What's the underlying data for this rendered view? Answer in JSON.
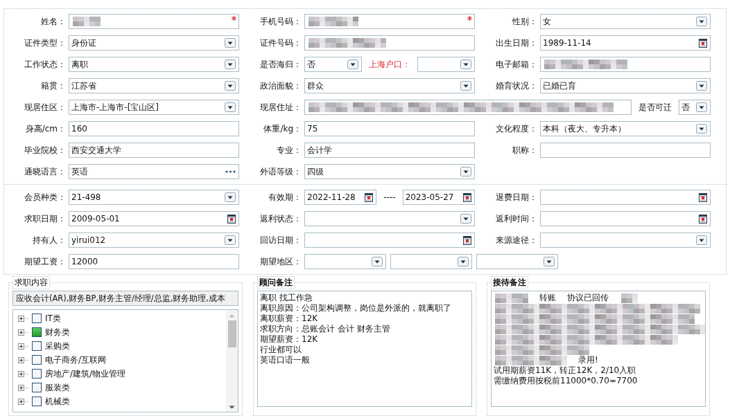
{
  "sections": [
    {
      "rows": [
        [
          {
            "label": "姓名：",
            "items": [
              {
                "kind": "text",
                "blurred": true,
                "required": true
              }
            ]
          },
          {
            "label": "手机号码：",
            "items": [
              {
                "kind": "text",
                "blurred": true,
                "required": true
              }
            ]
          },
          {
            "label": "性别：",
            "items": [
              {
                "kind": "select",
                "value": "女"
              }
            ]
          }
        ],
        [
          {
            "label": "证件类型：",
            "items": [
              {
                "kind": "select",
                "value": "身份证"
              }
            ]
          },
          {
            "label": "证件号码：",
            "items": [
              {
                "kind": "text",
                "blurred": true
              }
            ]
          },
          {
            "label": "出生日期：",
            "items": [
              {
                "kind": "date",
                "value": "1989-11-14"
              }
            ]
          }
        ],
        [
          {
            "label": "工作状态：",
            "items": [
              {
                "kind": "select",
                "value": "离职"
              }
            ]
          },
          {
            "label": "是否海归：",
            "items": [
              {
                "kind": "select",
                "value": "否"
              },
              {
                "kind": "label",
                "text": "上海户口：",
                "highlight": true
              },
              {
                "kind": "select"
              }
            ]
          },
          {
            "label": "电子邮箱：",
            "items": [
              {
                "kind": "text",
                "blurred": true
              }
            ]
          }
        ],
        [
          {
            "label": "籍贯：",
            "items": [
              {
                "kind": "select",
                "value": "江苏省"
              }
            ]
          },
          {
            "label": "政治面貌：",
            "items": [
              {
                "kind": "select",
                "value": "群众"
              }
            ]
          },
          {
            "label": "婚育状况：",
            "items": [
              {
                "kind": "select",
                "value": "已婚已育"
              }
            ]
          }
        ],
        [
          {
            "label": "现居住区：",
            "items": [
              {
                "kind": "select",
                "value": " 上海市-上海市-[宝山区]"
              }
            ]
          },
          {
            "label": "现居住址：",
            "wide": true,
            "items": [
              {
                "kind": "text",
                "blurred": true
              },
              {
                "kind": "label",
                "text": "是否可迁",
                "highlight": false
              },
              {
                "kind": "select",
                "value": "否"
              }
            ]
          }
        ],
        [
          {
            "label": "身高/cm：",
            "items": [
              {
                "kind": "text",
                "value": "160"
              }
            ]
          },
          {
            "label": "体重/kg：",
            "items": [
              {
                "kind": "text",
                "value": "75"
              }
            ]
          },
          {
            "label": "文化程度：",
            "items": [
              {
                "kind": "select",
                "value": "本科（夜大、专升本）"
              }
            ]
          }
        ],
        [
          {
            "label": "毕业院校：",
            "items": [
              {
                "kind": "text",
                "value": "西安交通大学"
              }
            ]
          },
          {
            "label": "专业：",
            "items": [
              {
                "kind": "text",
                "value": "会计学"
              }
            ]
          },
          {
            "label": "职称：",
            "items": [
              {
                "kind": "text"
              }
            ]
          }
        ],
        [
          {
            "label": "通晓语言：",
            "items": [
              {
                "kind": "picker",
                "value": "英语"
              }
            ]
          },
          {
            "label": "外语等级：",
            "items": [
              {
                "kind": "select",
                "value": "四级"
              }
            ]
          }
        ]
      ]
    },
    {
      "rows": [
        [
          {
            "label": "会员种类：",
            "items": [
              {
                "kind": "select",
                "value": " 21-498"
              }
            ]
          },
          {
            "label": "有效期：",
            "items": [
              {
                "kind": "date",
                "value": "2022-11-28"
              },
              {
                "kind": "dash",
                "text": "----"
              },
              {
                "kind": "date",
                "value": "2023-05-27"
              }
            ]
          },
          {
            "label": "退费日期：",
            "items": [
              {
                "kind": "date"
              }
            ]
          }
        ],
        [
          {
            "label": "求职日期：",
            "items": [
              {
                "kind": "date",
                "value": "2009-05-01"
              }
            ]
          },
          {
            "label": "返利状态：",
            "items": [
              {
                "kind": "select"
              }
            ]
          },
          {
            "label": "返利时间：",
            "items": [
              {
                "kind": "date"
              }
            ]
          }
        ],
        [
          {
            "label": "持有人：",
            "items": [
              {
                "kind": "select",
                "value": "yirui012"
              }
            ]
          },
          {
            "label": "回访日期：",
            "items": [
              {
                "kind": "date"
              }
            ]
          },
          {
            "label": "来源途径：",
            "items": [
              {
                "kind": "select"
              }
            ]
          }
        ],
        [
          {
            "label": "期望工资：",
            "items": [
              {
                "kind": "text",
                "value": "12000"
              }
            ]
          },
          {
            "label": "期望地区：",
            "wide": true,
            "items": [
              {
                "kind": "select"
              },
              {
                "kind": "select"
              },
              {
                "kind": "select"
              }
            ]
          }
        ]
      ]
    }
  ],
  "job_content": {
    "title": "求职内容",
    "selection": "应收会计(AR),财务BP,财务主管/经理/总监,财务助理,成本",
    "tree": [
      {
        "label": "IT类",
        "checked": false,
        "expanded": false
      },
      {
        "label": "财务类",
        "checked": true,
        "expanded": false
      },
      {
        "label": "采购类",
        "checked": false,
        "expanded": false
      },
      {
        "label": "电子商务/互联网",
        "checked": false,
        "expanded": false
      },
      {
        "label": "房地产/建筑/物业管理",
        "checked": false,
        "expanded": false
      },
      {
        "label": "服装类",
        "checked": false,
        "expanded": false
      },
      {
        "label": "机械类",
        "checked": false,
        "expanded": false
      }
    ]
  },
  "notes": [
    {
      "title": "顾问备注",
      "lines": [
        [
          {
            "kind": "text",
            "text": "离职 找工作急"
          }
        ],
        [
          {
            "kind": "text",
            "text": "离职原因：公司架构调整，岗位是外派的，就离职了"
          }
        ],
        [
          {
            "kind": "text",
            "text": "离职薪资：12K"
          }
        ],
        [
          {
            "kind": "text",
            "text": "求职方向：总账会计 会计 财务主管"
          }
        ],
        [
          {
            "kind": "text",
            "text": "期望薪资：12K"
          }
        ],
        [
          {
            "kind": "text",
            "text": "行业都可以"
          }
        ],
        [
          {
            "kind": "text",
            "text": "英语口语一般"
          }
        ]
      ]
    },
    {
      "title": "接待备注",
      "lines": [
        [
          {
            "kind": "blur"
          },
          {
            "kind": "text",
            "text": "转账"
          },
          {
            "kind": "text",
            "text": "协议已回传"
          },
          {
            "kind": "blur"
          }
        ],
        [
          {
            "kind": "blur"
          }
        ],
        [
          {
            "kind": "blur"
          }
        ],
        [
          {
            "kind": "blur"
          }
        ],
        [
          {
            "kind": "blur"
          }
        ],
        [
          {
            "kind": "blur"
          }
        ],
        [
          {
            "kind": "blur"
          },
          {
            "kind": "text",
            "text": "录用!"
          }
        ],
        [
          {
            "kind": "text",
            "text": "试用期薪资11K，转正12K，2/10入职"
          }
        ],
        [
          {
            "kind": "text",
            "text": "需缴纳费用按税前11000*0.70=7700"
          }
        ]
      ]
    }
  ]
}
